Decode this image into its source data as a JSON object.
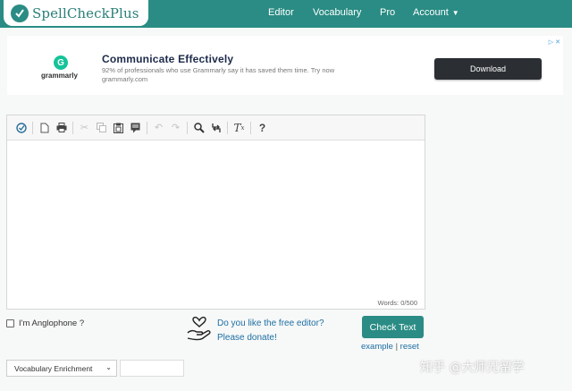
{
  "navbar": {
    "logo_text": "SpellCheckPlus",
    "items": [
      {
        "label": "Editor"
      },
      {
        "label": "Vocabulary"
      },
      {
        "label": "Pro"
      },
      {
        "label": "Account"
      }
    ],
    "color": "#2a8c84"
  },
  "ad": {
    "brand": "grammarly",
    "title": "Communicate Effectively",
    "description": "92% of professionals who use Grammarly say it has saved them time. Try now grammarly.com",
    "cta": "Download",
    "brand_color": "#15c39a"
  },
  "toolbar": {
    "icons": [
      "spellcheck-icon",
      "new-document-icon",
      "print-icon",
      "cut-icon",
      "copy-icon",
      "paste-icon",
      "paste-text-icon",
      "undo-icon",
      "redo-icon",
      "find-icon",
      "replace-icon",
      "remove-format-icon",
      "help-icon"
    ]
  },
  "editor": {
    "word_count": "Words: 0/500"
  },
  "options": {
    "anglophone_label": "I'm Anglophone ?",
    "donate_line1": "Do you like the free editor?",
    "donate_line2": "Please donate!",
    "check_button": "Check Text",
    "example_link": "example",
    "separator": "|",
    "reset_link": "reset"
  },
  "vocab": {
    "selected": "Vocabulary Enrichment"
  },
  "watermark": "知乎 @大师兄留学"
}
